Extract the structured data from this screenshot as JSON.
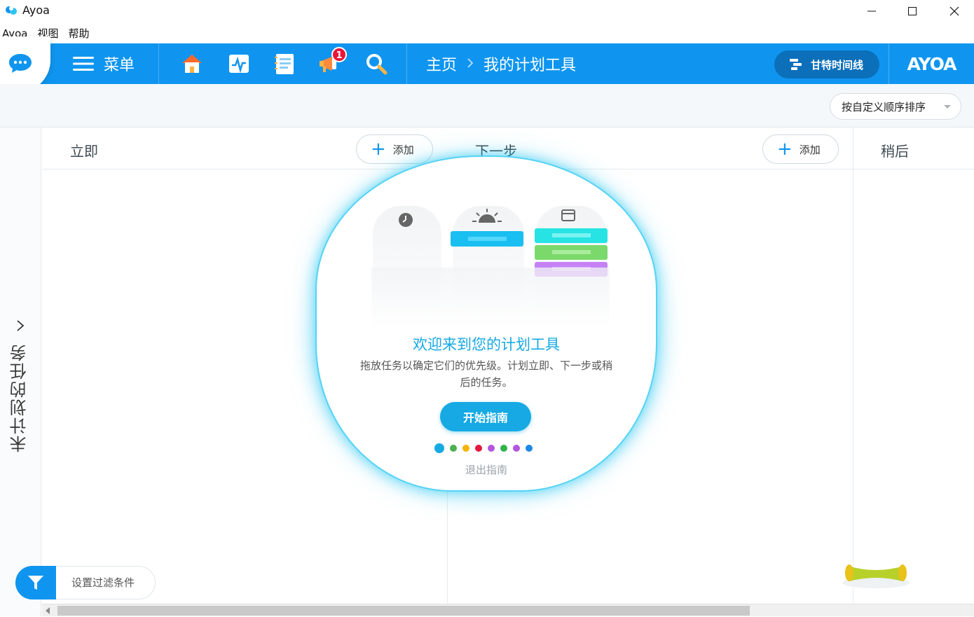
{
  "window": {
    "title": "Ayoa"
  },
  "menubar": {
    "items": [
      "Ayoa",
      "视图",
      "帮助"
    ]
  },
  "nav": {
    "menu_label": "菜单",
    "notification_count": "1",
    "breadcrumb": [
      "主页",
      "我的计划工具"
    ],
    "gantt_label": "甘特时间线",
    "brand": "AYOA",
    "accent_color": "#0f95ef"
  },
  "sort": {
    "selected": "按自定义顺序排序"
  },
  "sidebar": {
    "label": "未计划的任务"
  },
  "columns": [
    {
      "title": "立即",
      "add_label": "添加"
    },
    {
      "title": "下一步",
      "add_label": "添加"
    },
    {
      "title": "稍后"
    }
  ],
  "guide": {
    "title": "欢迎来到您的计划工具",
    "description": "拖放任务以确定它们的优先级。计划立即、下一步或稍后的任务。",
    "start_label": "开始指南",
    "exit_label": "退出指南",
    "dot_colors": [
      "#16a9e3",
      "#4caf50",
      "#f4b400",
      "#e8163b",
      "#b455e0",
      "#2fb34a",
      "#b455e0",
      "#1e88e5"
    ]
  },
  "filter": {
    "label": "设置过滤条件"
  }
}
